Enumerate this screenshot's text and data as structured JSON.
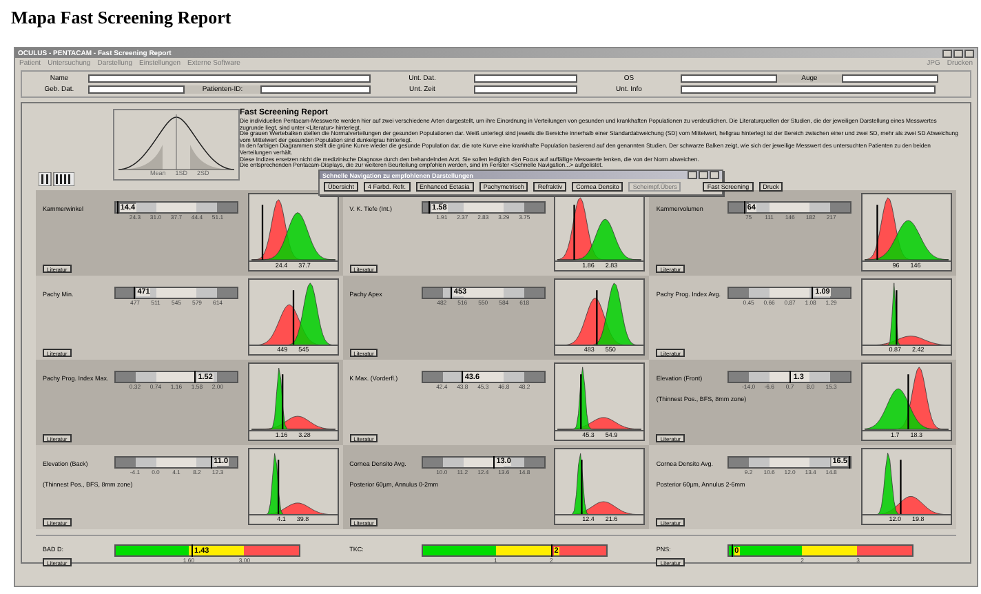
{
  "page_title": "Mapa Fast Screening Report",
  "window": {
    "title": "OCULUS - PENTACAM - Fast Screening Report"
  },
  "menu": [
    "Patient",
    "Untersuchung",
    "Darstellung",
    "Einstellungen",
    "Externe Software"
  ],
  "menu_right": [
    "JPG",
    "Drucken"
  ],
  "patient_fields": [
    [
      {
        "label": "Name"
      },
      {
        "label": "Unt. Dat."
      },
      {
        "label": "OS"
      },
      {
        "label": "Auge"
      }
    ],
    [
      {
        "label": "Geb. Dat."
      },
      {
        "label": "Patienten-ID:"
      },
      {
        "label": "Unt. Zeit"
      },
      {
        "label": "Unt. Info"
      }
    ]
  ],
  "legend": {
    "labels": [
      "Mean",
      "1SD",
      "2SD"
    ]
  },
  "info": {
    "heading": "Fast Screening Report",
    "paragraphs": [
      "Die individuellen Pentacam-Messwerte werden hier auf zwei verschiedene Arten dargestellt, um ihre Einordnung in Verteilungen von gesunden und krankhaften Populationen zu verdeutlichen. Die Literaturquellen der Studien, die der jeweiligen Darstellung eines Messwertes zugrunde liegt, sind unter <Literatur> hinterlegt.",
      "Die grauen Wertebalken stellen die Normalverteilungen der gesunden Populationen dar. Weiß unterlegt sind jeweils die Bereiche innerhalb einer Standardabweichung (SD) vom Mittelwert, hellgrau hinterlegt ist der Bereich zwischen einer und zwei SD, mehr als zwei SD Abweichung vom Mittelwert der gesunden Population sind dunkelgrau hinterlegt.",
      "In den farbigen Diagrammen stellt die grüne Kurve wieder die gesunde Population dar, die rote Kurve eine krankhafte Population basierend auf den genannten Studien. Der schwarze Balken zeigt, wie sich der jeweilige Messwert des untersuchten Patienten zu den beiden Verteilungen verhält.",
      "Diese Indizes ersetzen nicht die medizinische Diagnose durch den behandelnden Arzt. Sie sollen lediglich den Focus auf auffällige Messwerte lenken, die von der Norm abweichen.",
      "Die entsprechenden Pentacam-Displays, die zur weiteren Beurteilung empfohlen werden, sind im Fenster <Schnelle Navigation...> aufgelistet."
    ]
  },
  "navigation": {
    "title": "Schnelle Navigation zu empfohlenen Darstellungen",
    "buttons": [
      {
        "label": "Übersicht",
        "disabled": false
      },
      {
        "label": "4 Farbd. Refr.",
        "disabled": false
      },
      {
        "label": "Enhanced Ectasia",
        "disabled": false
      },
      {
        "label": "Pachymetrisch",
        "disabled": false
      },
      {
        "label": "Refraktiv",
        "disabled": false
      },
      {
        "label": "Cornea Densito",
        "disabled": false
      },
      {
        "label": "Scheimpf.Übers",
        "disabled": true
      },
      {
        "label": "Fast Screening",
        "disabled": false
      },
      {
        "label": "Druck",
        "disabled": false
      }
    ]
  },
  "parameters": [
    {
      "label": "Kammerwinkel",
      "value": "14.4",
      "level": 0.01,
      "ticks": [
        "24.3",
        "31.0",
        "37.7",
        "44.4",
        "51.1"
      ],
      "chart_labels": [
        "24.4",
        "37.7"
      ],
      "button": "Literatur"
    },
    {
      "label": "V. K. Tiefe (Int.)",
      "value": "1.58",
      "level": 0.05,
      "ticks": [
        "1.91",
        "2.37",
        "2.83",
        "3.29",
        "3.75"
      ],
      "chart_labels": [
        "1.86",
        "2.83"
      ],
      "button": "Literatur"
    },
    {
      "label": "Kammervolumen",
      "value": "64",
      "level": 0.12,
      "ticks": [
        "75",
        "111",
        "146",
        "182",
        "217"
      ],
      "chart_labels": [
        "96",
        "146"
      ],
      "button": "Literatur"
    },
    {
      "label": "Pachy Min.",
      "value": "471",
      "level": 0.15,
      "ticks": [
        "477",
        "511",
        "545",
        "579",
        "614"
      ],
      "chart_labels": [
        "449",
        "545"
      ],
      "button": "Literatur"
    },
    {
      "label": "Pachy Apex",
      "value": "453",
      "level": 0.23,
      "ticks": [
        "482",
        "516",
        "550",
        "584",
        "618"
      ],
      "chart_labels": [
        "483",
        "550"
      ],
      "button": "Literatur"
    },
    {
      "label": "Pachy Prog. Index Avg.",
      "value": "1.09",
      "level": 0.68,
      "ticks": [
        "0.45",
        "0.66",
        "0.87",
        "1.08",
        "1.29"
      ],
      "chart_labels": [
        "0.87",
        "2.42"
      ],
      "button": "Literatur"
    },
    {
      "label": "Pachy Prog. Index Max.",
      "value": "1.52",
      "level": 0.65,
      "ticks": [
        "0.32",
        "0.74",
        "1.16",
        "1.58",
        "2.00"
      ],
      "chart_labels": [
        "1.16",
        "3.28"
      ],
      "button": "Literatur"
    },
    {
      "label": "K Max. (Vorderfl.)",
      "value": "43.6",
      "level": 0.32,
      "ticks": [
        "42.4",
        "43.8",
        "45.3",
        "46.8",
        "48.2"
      ],
      "chart_labels": [
        "45.3",
        "54.9"
      ],
      "button": "Literatur"
    },
    {
      "label": "Elevation (Front)",
      "sublabel": "(Thinnest Pos., BFS, 8mm zone)",
      "value": "1.3",
      "level": 0.5,
      "ticks": [
        "-14.0",
        "-6.6",
        "0.7",
        "8.0",
        "15.3"
      ],
      "chart_labels": [
        "1.7",
        "18.3"
      ],
      "button": "Literatur"
    },
    {
      "label": "Elevation (Back)",
      "sublabel": "(Thinnest Pos., BFS, 8mm zone)",
      "value": "11.0",
      "level": 0.78,
      "ticks": [
        "-4.1",
        "0.0",
        "4.1",
        "8.2",
        "12.3"
      ],
      "chart_labels": [
        "4.1",
        "39.8"
      ],
      "button": "Literatur"
    },
    {
      "label": "Cornea Densito Avg.",
      "sublabel": "Posterior 60µm, Annulus 0-2mm",
      "value": "13.0",
      "level": 0.58,
      "ticks": [
        "10.0",
        "11.2",
        "12.4",
        "13.6",
        "14.8"
      ],
      "chart_labels": [
        "12.4",
        "21.6"
      ],
      "button": "Literatur"
    },
    {
      "label": "Cornea Densito Avg.",
      "sublabel": "Posterior 60µm, Annulus 2-6mm",
      "value": "16.5",
      "level": 0.99,
      "ticks": [
        "9.2",
        "10.6",
        "12.0",
        "13.4",
        "14.8"
      ],
      "chart_labels": [
        "12.0",
        "19.8"
      ],
      "button": "Literatur"
    }
  ],
  "indices": [
    {
      "label": "BAD D:",
      "value": "1.43",
      "level": 0.41,
      "ticks": [
        "1.60",
        "3.00"
      ],
      "button": "Literatur"
    },
    {
      "label": "TKC:",
      "value": "2",
      "level": 0.7,
      "ticks": [
        "1",
        "2"
      ]
    },
    {
      "label": "PNS:",
      "value": "0",
      "level": 0.01,
      "ticks": [
        "2",
        "3"
      ],
      "button": "Literatur"
    }
  ]
}
